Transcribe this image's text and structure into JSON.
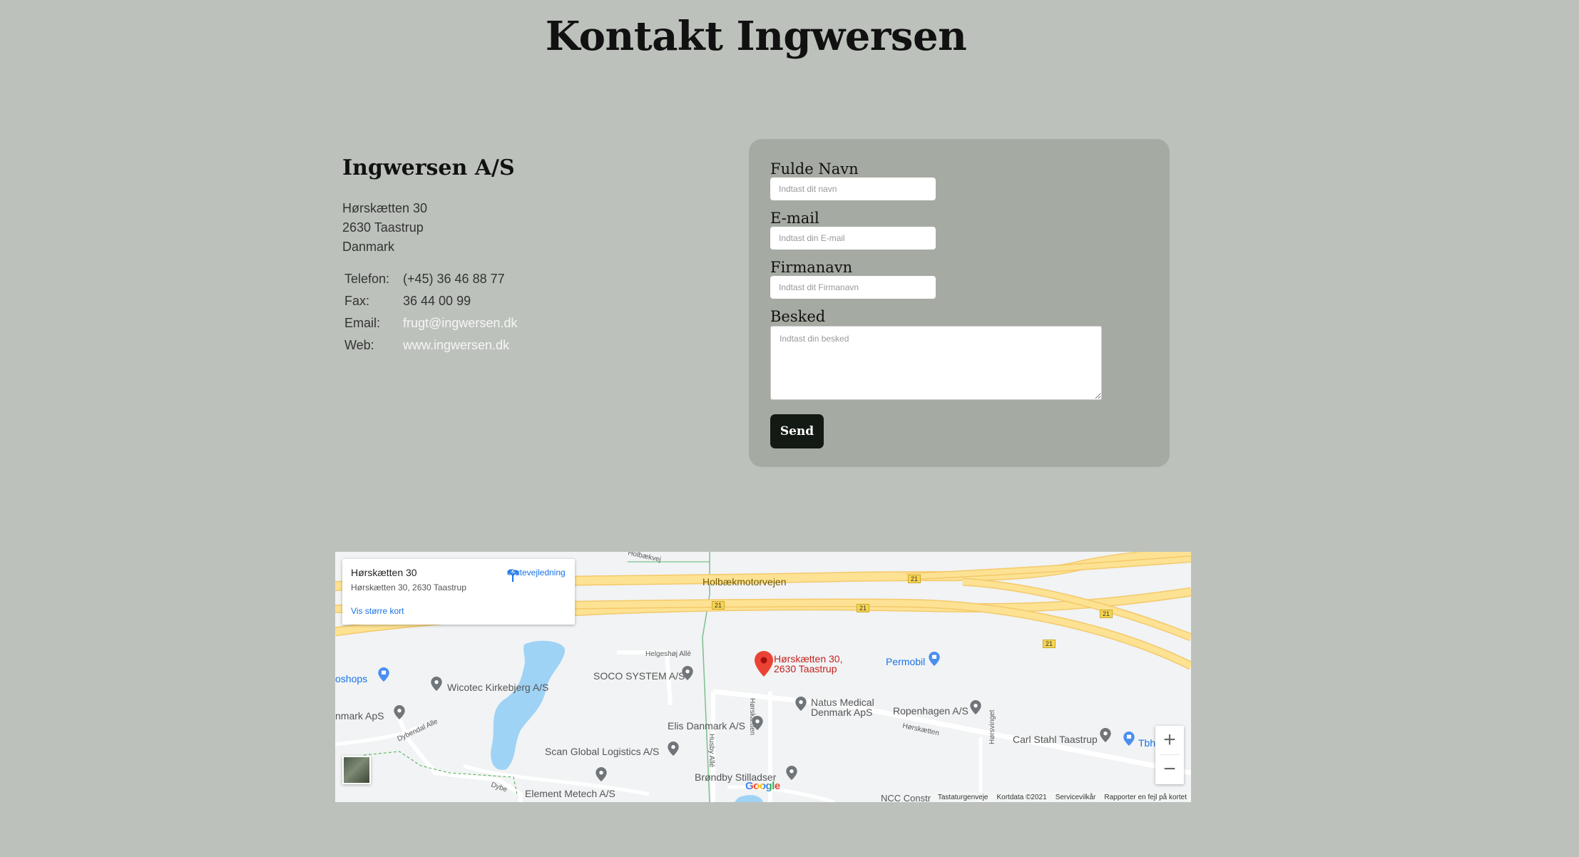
{
  "page": {
    "title": "Kontakt Ingwersen"
  },
  "company": {
    "name": "Ingwersen A/S",
    "address": [
      "Hørskætten 30",
      "2630 Taastrup",
      "Danmark"
    ],
    "contacts": [
      {
        "label": "Telefon:",
        "value": "(+45) 36 46 88 77"
      },
      {
        "label": "Fax:",
        "value": "36 44 00 99"
      },
      {
        "label": "Email:",
        "value": "frugt@ingwersen.dk"
      },
      {
        "label": "Web:",
        "value": "www.ingwersen.dk"
      }
    ]
  },
  "form": {
    "name_label": "Fulde Navn",
    "name_placeholder": "Indtast dit navn",
    "email_label": "E-mail",
    "email_placeholder": "Indtast din E-mail",
    "company_label": "Firmanavn",
    "company_placeholder": "Indtast dit Firmanavn",
    "message_label": "Besked",
    "message_placeholder": "Indtast din besked",
    "send_label": "Send"
  },
  "map": {
    "card_title": "Hørskætten 30",
    "card_address": "Hørskætten 30, 2630 Taastrup",
    "directions_label": "Rutevejledning",
    "larger_map_label": "Vis større kort",
    "marker_label_1": "Hørskætten 30,",
    "marker_label_2": "2630 Taastrup",
    "road_labels": {
      "motorway": "Holbækmotorvejen",
      "helgeshoj": "Helgeshøj Allé",
      "dybendal": "Dybendal Alle",
      "dybendal_2": "Dybe",
      "horskaetten": "Hørskætten",
      "horskaetten_v": "Hørskætten",
      "horsvinget": "Hørsvinget",
      "husby": "Husby Allé",
      "holbaek": "Holbækvej"
    },
    "route_numbers": [
      "21",
      "21",
      "21",
      "21",
      "21"
    ],
    "places": [
      {
        "name": "Permobil"
      },
      {
        "name": "SOCO SYSTEM A/S"
      },
      {
        "name": "Wicotec Kirkebjerg A/S"
      },
      {
        "name": "oshops"
      },
      {
        "name": "nmark ApS"
      },
      {
        "name": "Natus Medical Denmark ApS"
      },
      {
        "name": "Ropenhagen A/S"
      },
      {
        "name": "Elis Danmark A/S"
      },
      {
        "name": "Scan Global Logistics A/S"
      },
      {
        "name": "Brøndby Stilladser"
      },
      {
        "name": "Element Metech A/S"
      },
      {
        "name": "Carl Stahl Taastrup"
      },
      {
        "name": "Tbh"
      },
      {
        "name": "NCC Constr"
      }
    ],
    "zoom_in": "+",
    "zoom_out": "−",
    "footer": [
      "Tastaturgenveje",
      "Kortdata ©2021",
      "Servicevilkår",
      "Rapporter en fejl på kortet"
    ],
    "google_logo": "Google",
    "colors": {
      "major_road": "#fde293",
      "road_outline": "#f4c96b",
      "water": "#9fd3f5",
      "marker": "#ea4335",
      "poi_gray": "#70757a",
      "poi_blue": "#4a8ef0"
    },
    "icons": {
      "pin": "map-pin-icon",
      "directions": "directions-icon"
    }
  }
}
